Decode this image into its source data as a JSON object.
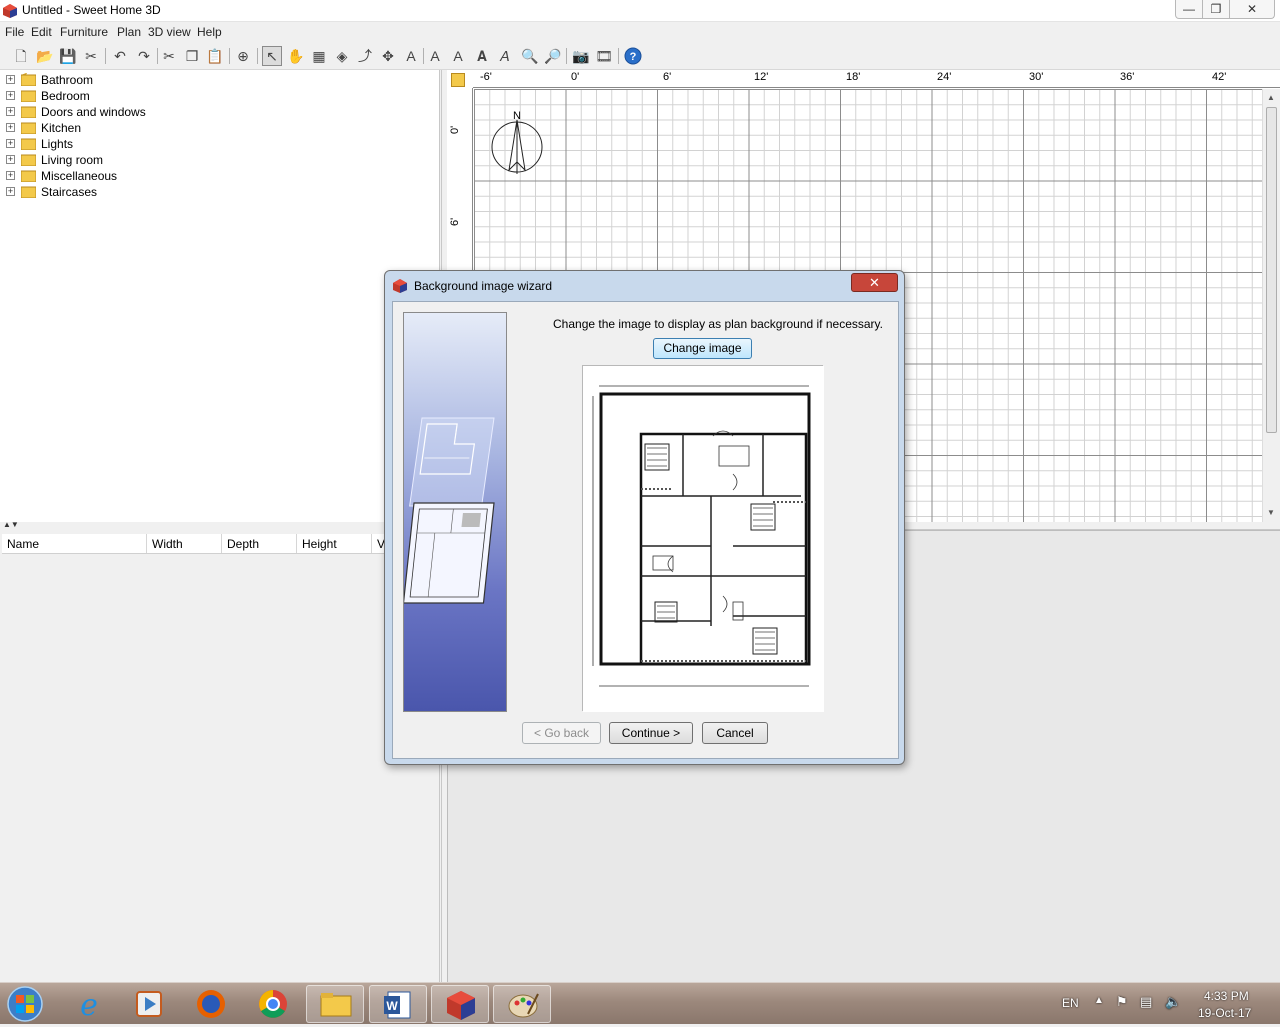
{
  "window": {
    "title": "Untitled - Sweet Home 3D",
    "minimize": "—",
    "maximize": "❐",
    "close": "✕"
  },
  "menu": [
    "File",
    "Edit",
    "Furniture",
    "Plan",
    "3D view",
    "Help"
  ],
  "catalog": {
    "categories": [
      "Bathroom",
      "Bedroom",
      "Doors and windows",
      "Kitchen",
      "Lights",
      "Living room",
      "Miscellaneous",
      "Staircases"
    ]
  },
  "furniture_table": {
    "columns": [
      "Name",
      "Width",
      "Depth",
      "Height",
      "V"
    ]
  },
  "plan": {
    "ruler_top": [
      "-6'",
      "0'",
      "6'",
      "12'",
      "18'",
      "24'",
      "30'",
      "36'",
      "42'"
    ],
    "ruler_left": [
      "0'",
      "6'"
    ],
    "compass_label": "N"
  },
  "dialog": {
    "title": "Background image wizard",
    "close": "✕",
    "message": "Change the image to display as plan background if necessary.",
    "change_image": "Change image",
    "go_back": "< Go back",
    "continue": "Continue >",
    "cancel": "Cancel"
  },
  "taskbar": {
    "language": "EN",
    "time": "4:33 PM",
    "date": "19-Oct-17"
  },
  "colors": {
    "accent": "#3c7fb1",
    "dialog_close": "#c7463a",
    "wizard_blue": "#4a56ac"
  }
}
